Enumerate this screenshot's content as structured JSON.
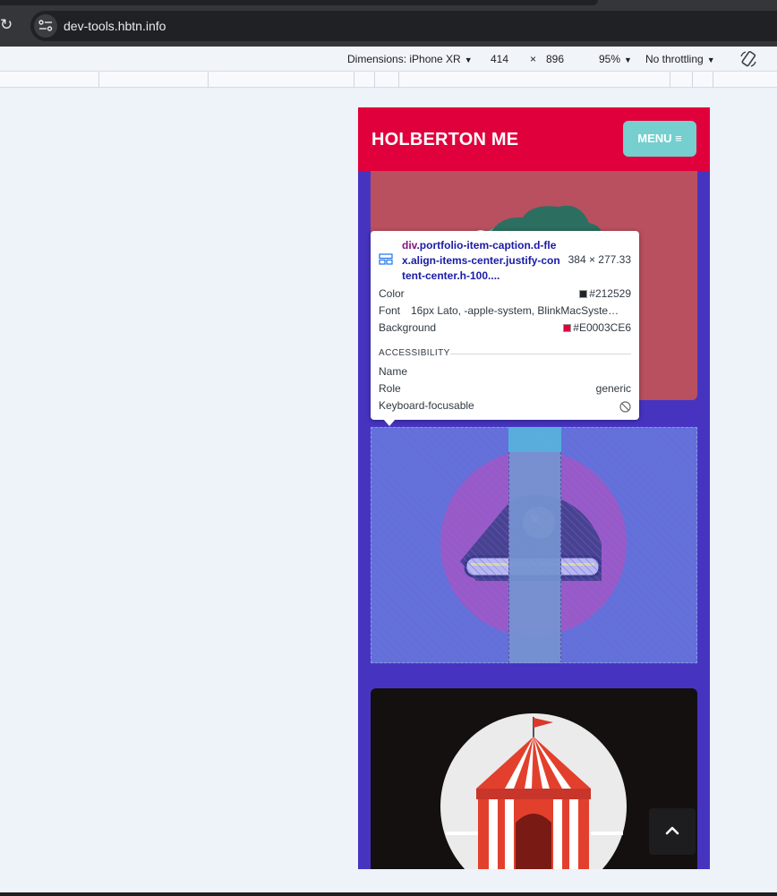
{
  "browser": {
    "url": "dev-tools.hbtn.info"
  },
  "device_toolbar": {
    "dimensions_label": "Dimensions: iPhone XR",
    "width": "414",
    "times": "×",
    "height": "896",
    "zoom": "95%",
    "throttling": "No throttling"
  },
  "page": {
    "brand": "HOLBERTON ME",
    "menu_label": "MENU",
    "colors": {
      "navbar": "#e0003c",
      "background": "#4634c1",
      "menu_button": "#76cfcf"
    }
  },
  "inspect_tooltip": {
    "selector_tag": "div",
    "selector_classes": ".portfolio-item-caption.d-flex.align-items-center.justify-content-center.h-100....",
    "size": "384 × 277.33",
    "rows": {
      "color_label": "Color",
      "color_value": "#212529",
      "color_swatch": "#212529",
      "font_label": "Font",
      "font_value": "16px Lato, -apple-system, BlinkMacSyste…",
      "background_label": "Background",
      "background_value": "#E0003CE6",
      "background_swatch": "#e0003c"
    },
    "accessibility": {
      "header": "ACCESSIBILITY",
      "name_label": "Name",
      "role_label": "Role",
      "role_value": "generic",
      "focusable_label": "Keyboard-focusable"
    }
  },
  "icons": {
    "reload": "reload-icon",
    "site_info": "site-info-icon",
    "rotate": "rotate-icon",
    "element": "element-layout-icon",
    "not_focusable": "not-focusable-icon",
    "hamburger": "hamburger-icon",
    "chevron_up": "chevron-up-icon"
  }
}
